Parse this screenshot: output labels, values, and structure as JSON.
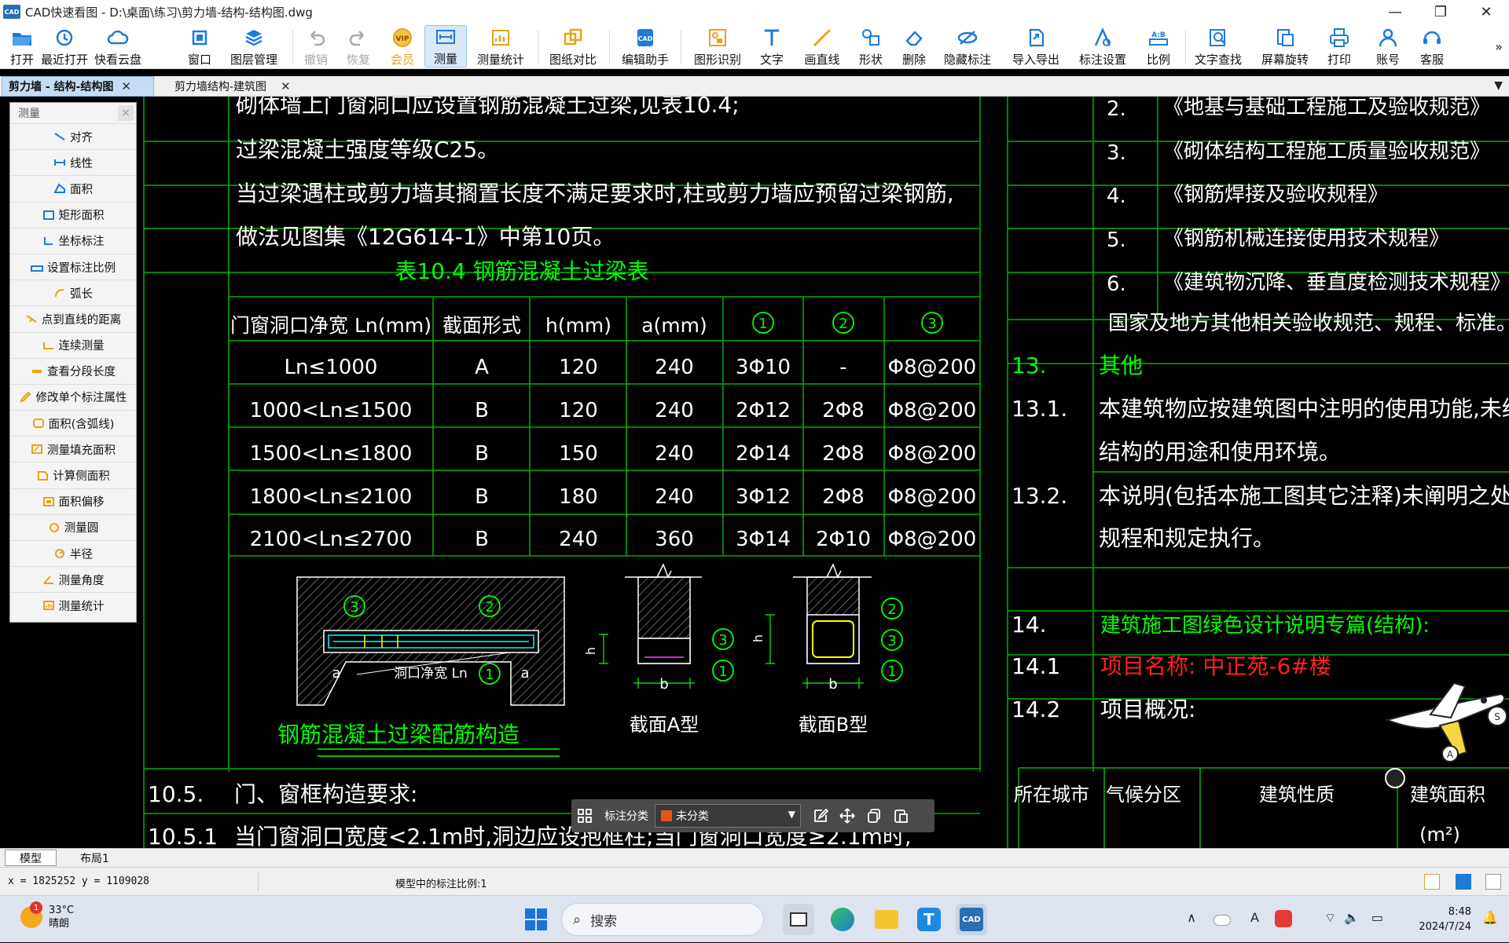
{
  "window": {
    "title": "CAD快速看图 - D:\\桌面\\练习\\剪力墙-结构-结构图.dwg",
    "logo": "CAD",
    "controls": {
      "minimize": "—",
      "maximize": "❐",
      "close": "✕"
    }
  },
  "toolbar": {
    "items": [
      {
        "label": "打开",
        "icon": "folder-icon"
      },
      {
        "label": "最近打开",
        "icon": "history-icon"
      },
      {
        "label": "快看云盘",
        "icon": "cloud-icon"
      },
      {
        "label": "窗口",
        "icon": "window-icon"
      },
      {
        "label": "图层管理",
        "icon": "layers-icon"
      },
      {
        "label": "撤销",
        "icon": "undo-icon"
      },
      {
        "label": "恢复",
        "icon": "redo-icon"
      },
      {
        "label": "会员",
        "icon": "vip-icon"
      },
      {
        "label": "测量",
        "icon": "measure-icon"
      },
      {
        "label": "测量统计",
        "icon": "measure-stats-icon"
      },
      {
        "label": "图纸对比",
        "icon": "compare-icon"
      },
      {
        "label": "编辑助手",
        "icon": "edit-assistant-icon"
      },
      {
        "label": "图形识别",
        "icon": "shape-recognize-icon"
      },
      {
        "label": "文字",
        "icon": "text-icon"
      },
      {
        "label": "画直线",
        "icon": "line-icon"
      },
      {
        "label": "形状",
        "icon": "shape-icon"
      },
      {
        "label": "删除",
        "icon": "eraser-icon"
      },
      {
        "label": "隐藏标注",
        "icon": "hide-annotation-icon"
      },
      {
        "label": "导入导出",
        "icon": "import-export-icon"
      },
      {
        "label": "标注设置",
        "icon": "annotation-settings-icon"
      },
      {
        "label": "比例",
        "icon": "scale-icon"
      },
      {
        "label": "文字查找",
        "icon": "text-search-icon"
      },
      {
        "label": "屏幕旋转",
        "icon": "rotate-icon"
      },
      {
        "label": "打印",
        "icon": "print-icon"
      },
      {
        "label": "账号",
        "icon": "account-icon"
      },
      {
        "label": "客服",
        "icon": "support-icon"
      }
    ],
    "more": "»",
    "vip_badge": "VIP",
    "scale_badge": "A:B",
    "colors": {
      "icon_blue": "#1e7bd8",
      "disabled": "#a8a8a8",
      "vip_orange": "#e8a21a"
    }
  },
  "tabs": [
    {
      "label": "剪力墙 - 结构-结构图",
      "close": "✕"
    },
    {
      "label": "剪力墙结构-建筑图",
      "close": "✕"
    }
  ],
  "tab_dropdown": "▼",
  "measure_panel": {
    "title": "测量",
    "close": "×",
    "items": [
      {
        "label": "对齐",
        "icon": "align-measure-icon"
      },
      {
        "label": "线性",
        "icon": "linear-measure-icon"
      },
      {
        "label": "面积",
        "icon": "area-icon"
      },
      {
        "label": "矩形面积",
        "icon": "rect-area-icon"
      },
      {
        "label": "坐标标注",
        "icon": "coordinate-icon"
      },
      {
        "label": "设置标注比例",
        "icon": "set-scale-icon"
      },
      {
        "label": "弧长",
        "icon": "arc-length-icon"
      },
      {
        "label": "点到直线的距离",
        "icon": "point-line-distance-icon"
      },
      {
        "label": "连续测量",
        "icon": "continuous-measure-icon"
      },
      {
        "label": "查看分段长度",
        "icon": "segment-length-icon"
      },
      {
        "label": "修改单个标注属性",
        "icon": "edit-annotation-icon"
      },
      {
        "label": "面积(含弧线)",
        "icon": "arc-area-icon"
      },
      {
        "label": "测量填充面积",
        "icon": "fill-area-icon"
      },
      {
        "label": "计算侧面积",
        "icon": "side-area-icon"
      },
      {
        "label": "面积偏移",
        "icon": "area-offset-icon"
      },
      {
        "label": "测量圆",
        "icon": "circle-measure-icon"
      },
      {
        "label": "半径",
        "icon": "radius-icon"
      },
      {
        "label": "测量角度",
        "icon": "angle-icon"
      },
      {
        "label": "测量统计",
        "icon": "stats-icon"
      }
    ]
  },
  "drawing": {
    "colors": {
      "grid": "#00b000",
      "white": "#ffffff",
      "green": "#00ff00",
      "red": "#ff2020",
      "cyan": "#00ffff",
      "yellow": "#ffff00"
    },
    "left_lines": [
      "砌体墙上门窗洞口应设置钢筋混凝土过梁,见表10.4;",
      "过梁混凝土强度等级C25。",
      "当过梁遇柱或剪力墙其搁置长度不满足要求时,柱或剪力墙应预留过梁钢筋,",
      "做法见图集《12G614-1》中第10页。"
    ],
    "table_title": "表10.4  钢筋混凝土过梁表",
    "table_headers": [
      "门窗洞口净宽 Ln(mm)",
      "截面形式",
      "h(mm)",
      "a(mm)",
      "1",
      "2",
      "3"
    ],
    "table_rows": [
      [
        "Ln≤1000",
        "A",
        "120",
        "240",
        "3Φ10",
        "-",
        "Φ8@200"
      ],
      [
        "1000<Ln≤1500",
        "B",
        "120",
        "240",
        "2Φ12",
        "2Φ8",
        "Φ8@200"
      ],
      [
        "1500<Ln≤1800",
        "B",
        "150",
        "240",
        "2Φ14",
        "2Φ8",
        "Φ8@200"
      ],
      [
        "1800<Ln≤2100",
        "B",
        "180",
        "240",
        "3Φ12",
        "2Φ8",
        "Φ8@200"
      ],
      [
        "2100<Ln≤2700",
        "B",
        "240",
        "360",
        "3Φ14",
        "2Φ10",
        "Φ8@200"
      ]
    ],
    "detail_caption": "钢筋混凝土过梁配筋构造",
    "section_a": "截面A型",
    "section_b": "截面B型",
    "opening_label": "洞口净宽 Ln",
    "mark_a": "a",
    "mark_b": "b",
    "mark_h": "h",
    "marks": [
      "1",
      "2",
      "3"
    ],
    "sec_10_5": {
      "no": "10.5.",
      "text": "门、窗框构造要求:"
    },
    "sec_10_5_1": {
      "no": "10.5.1",
      "text": "当门窗洞口宽度<2.1m时,洞边应设抱框柱;当门窗洞口宽度≥2.1m时,"
    },
    "right_list": [
      {
        "no": "2.",
        "text": "《地基与基础工程施工及验收规范》"
      },
      {
        "no": "3.",
        "text": "《砌体结构工程施工质量验收规范》"
      },
      {
        "no": "4.",
        "text": "《钢筋焊接及验收规程》"
      },
      {
        "no": "5.",
        "text": "《钢筋机械连接使用技术规程》"
      },
      {
        "no": "6.",
        "text": "《建筑物沉降、垂直度检测技术规程》"
      }
    ],
    "right_note": "国家及地方其他相关验收规范、规程、标准。",
    "sec_13": {
      "no": "13.",
      "text": "其他"
    },
    "sec_13_1": {
      "no": "13.1.",
      "line1": "本建筑物应按建筑图中注明的使用功能,未经技术鉴定或",
      "line2": "结构的用途和使用环境。"
    },
    "sec_13_2": {
      "no": "13.2.",
      "line1": "本说明(包括本施工图其它注释)未阐明之处,均按国家现",
      "line2": "规程和规定执行。"
    },
    "sec_14": {
      "no": "14.",
      "text": "建筑施工图绿色设计说明专篇(结构):"
    },
    "sec_14_1": {
      "no": "14.1",
      "text": "项目名称: 中正苑-6#楼"
    },
    "sec_14_2": {
      "no": "14.2",
      "text": "项目概况:"
    },
    "bottom_table": [
      "所在城市",
      "气候分区",
      "建筑性质",
      "建筑面积"
    ],
    "bottom_unit": "(m²)"
  },
  "annotation_bar": {
    "label": "标注分类",
    "selected": "未分类",
    "swatch": "#e8540e",
    "caret": "▼"
  },
  "mascot": {
    "badge": "A"
  },
  "layout_tabs": [
    "模型",
    "布局1"
  ],
  "status": {
    "coords": "x = 1825252  y = 1109028",
    "scale": "模型中的标注比例:1"
  },
  "taskbar": {
    "weather_temp": "33°C",
    "weather_desc": "晴朗",
    "weather_badge": "1",
    "search": "搜索",
    "search_icon": "⌕",
    "tray": {
      "chevron": "∧",
      "ime": "A",
      "wifi": "⌔",
      "volume": "🔈",
      "battery": "▭",
      "bell": "🔔"
    },
    "time": "8:48",
    "date": "2024/7/24"
  }
}
